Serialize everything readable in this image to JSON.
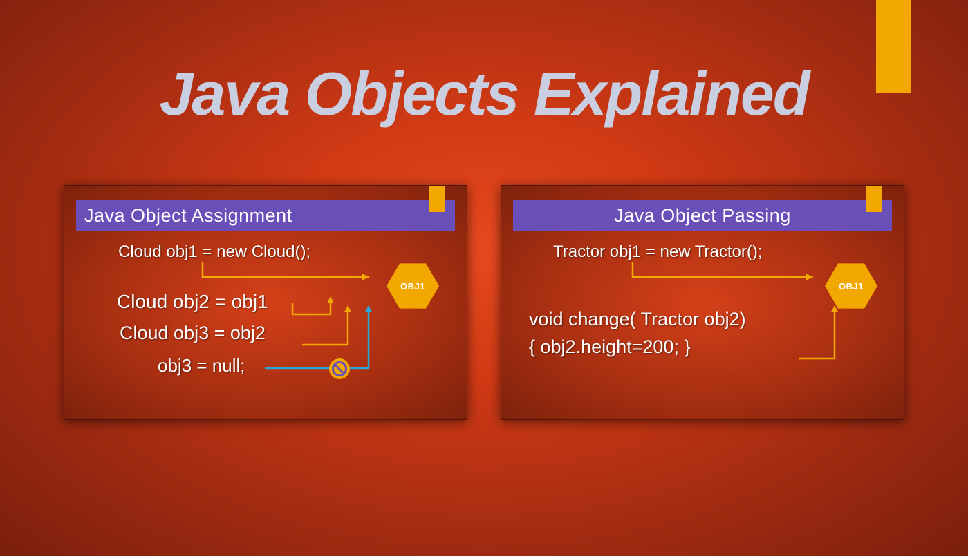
{
  "title": "Java Objects Explained",
  "panel_left": {
    "header": "Java Object Assignment",
    "line1": "Cloud obj1 = new Cloud();",
    "line2": "Cloud obj2 = obj1",
    "line3": "Cloud obj3 = obj2",
    "line4": "obj3 = null;",
    "hex_label": "OBJ1"
  },
  "panel_right": {
    "header": "Java Object Passing",
    "line1": "Tractor obj1 = new Tractor();",
    "line2": "void change( Tractor obj2)",
    "line3": "{ obj2.height=200; }",
    "hex_label": "OBJ1"
  }
}
